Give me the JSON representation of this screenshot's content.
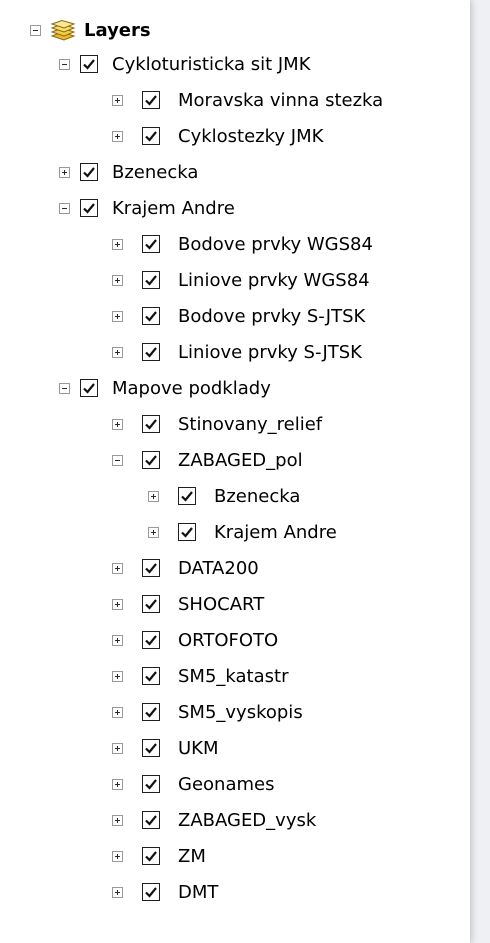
{
  "tree": {
    "root_label": "Layers",
    "root_icon": "layers-icon",
    "items": [
      {
        "label": "Cykloturisticka sit JMK",
        "expanded": true,
        "checked": true
      },
      {
        "label": "Moravska vinna stezka",
        "expanded": false,
        "checked": true
      },
      {
        "label": "Cyklostezky JMK",
        "expanded": false,
        "checked": true
      },
      {
        "label": "Bzenecka",
        "expanded": false,
        "checked": true
      },
      {
        "label": "Krajem Andre",
        "expanded": true,
        "checked": true
      },
      {
        "label": "Bodove prvky WGS84",
        "expanded": false,
        "checked": true
      },
      {
        "label": "Liniove prvky WGS84",
        "expanded": false,
        "checked": true
      },
      {
        "label": "Bodove prvky S-JTSK",
        "expanded": false,
        "checked": true
      },
      {
        "label": "Liniove prvky S-JTSK",
        "expanded": false,
        "checked": true
      },
      {
        "label": "Mapove podklady",
        "expanded": true,
        "checked": true
      },
      {
        "label": "Stinovany_relief",
        "expanded": false,
        "checked": true
      },
      {
        "label": "ZABAGED_pol",
        "expanded": true,
        "checked": true
      },
      {
        "label": "Bzenecka",
        "expanded": false,
        "checked": true
      },
      {
        "label": "Krajem Andre",
        "expanded": false,
        "checked": true
      },
      {
        "label": "DATA200",
        "expanded": false,
        "checked": true
      },
      {
        "label": "SHOCART",
        "expanded": false,
        "checked": true
      },
      {
        "label": "ORTOFOTO",
        "expanded": false,
        "checked": true
      },
      {
        "label": "SM5_katastr",
        "expanded": false,
        "checked": true
      },
      {
        "label": "SM5_vyskopis",
        "expanded": false,
        "checked": true
      },
      {
        "label": "UKM",
        "expanded": false,
        "checked": true
      },
      {
        "label": "Geonames",
        "expanded": false,
        "checked": true
      },
      {
        "label": "ZABAGED_vysk",
        "expanded": false,
        "checked": true
      },
      {
        "label": "ZM",
        "expanded": false,
        "checked": true
      },
      {
        "label": "DMT",
        "expanded": false,
        "checked": true
      }
    ]
  }
}
